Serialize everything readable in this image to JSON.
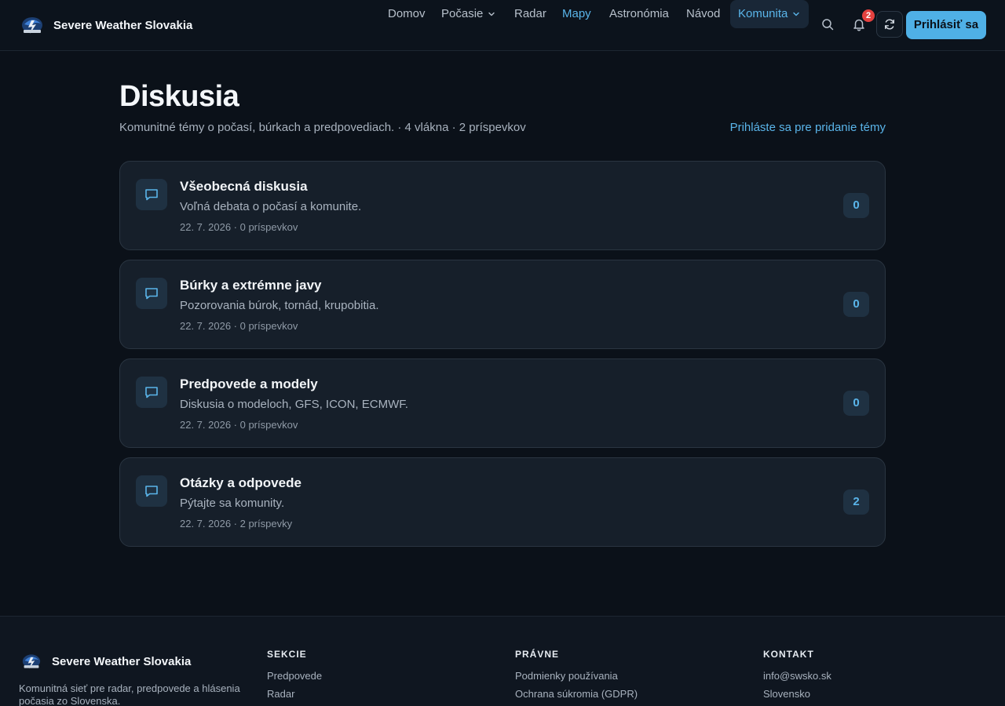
{
  "header": {
    "brand_name": "Severe Weather Slovakia",
    "nav": {
      "home": "Domov",
      "weather": "Počasie",
      "radar": "Radar",
      "maps": "Mapy",
      "astronomy": "Astronómia",
      "guide": "Návod",
      "community": "Komunita"
    },
    "notifications_count": "2",
    "login_label": "Prihlásiť sa"
  },
  "main": {
    "title": "Diskusia",
    "subtitle": "Komunitné témy o počasí, búrkach a predpovediach. · 4 vlákna · 2 príspevkov",
    "add_topic": "Prihláste sa pre pridanie témy",
    "threads": [
      {
        "title": "Všeobecná diskusia",
        "description": "Voľná debata o počasí a komunite.",
        "meta": "22. 7. 2026 · 0 príspevkov",
        "count": "0"
      },
      {
        "title": "Búrky a extrémne javy",
        "description": "Pozorovania búrok, tornád, krupobitia.",
        "meta": "22. 7. 2026 · 0 príspevkov",
        "count": "0"
      },
      {
        "title": "Predpovede a modely",
        "description": "Diskusia o modeloch, GFS, ICON, ECMWF.",
        "meta": "22. 7. 2026 · 0 príspevkov",
        "count": "0"
      },
      {
        "title": "Otázky a odpovede",
        "description": "Pýtajte sa komunity.",
        "meta": "22. 7. 2026 · 2 príspevky",
        "count": "2"
      }
    ]
  },
  "footer": {
    "brand_name": "Severe Weather Slovakia",
    "description": "Komunitná sieť pre radar, predpovede a hlásenia počasia zo Slovenska.",
    "sections": {
      "heading": "SEKCIE",
      "links": [
        "Predpovede",
        "Radar"
      ]
    },
    "legal": {
      "heading": "PRÁVNE",
      "links": [
        "Podmienky používania",
        "Ochrana súkromia (GDPR)"
      ]
    },
    "contact": {
      "heading": "KONTAKT",
      "links": [
        "info@swsko.sk",
        "Slovensko"
      ]
    }
  },
  "colors": {
    "background": "#0b1119",
    "card": "#161f2a",
    "accent": "#5ab5ea",
    "button": "#4fb0e6",
    "badge": "#e5413f"
  },
  "icons": {
    "logo": "storm-logo-icon",
    "search": "search-icon",
    "bell": "bell-icon",
    "refresh": "refresh-icon",
    "thread": "chat-bubble-icon",
    "dropdown": "chevron-down-icon"
  }
}
